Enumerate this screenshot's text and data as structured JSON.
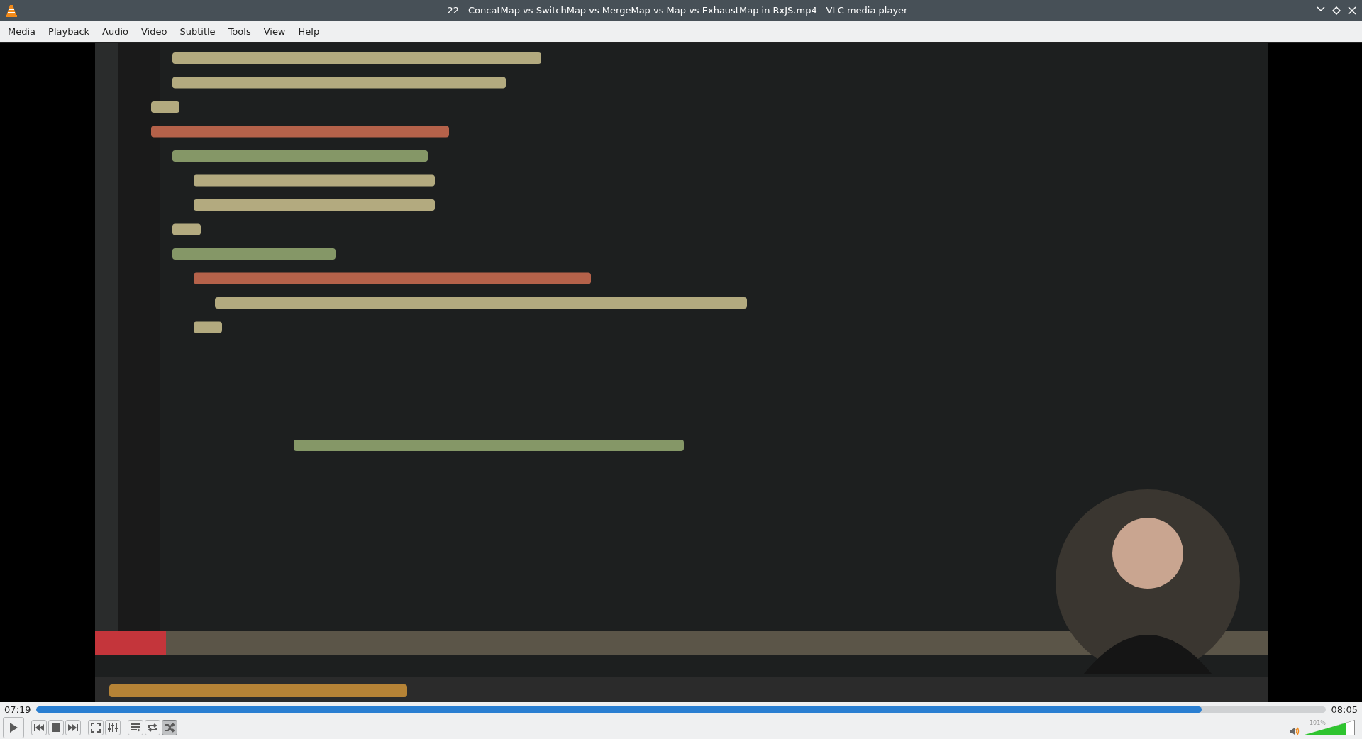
{
  "window": {
    "title": "22 - ConcatMap vs SwitchMap vs MergeMap vs Map vs ExhaustMap in RxJS.mp4 - VLC media player"
  },
  "menu": [
    "Media",
    "Playback",
    "Audio",
    "Video",
    "Subtitle",
    "Tools",
    "View",
    "Help"
  ],
  "video": {
    "kind": "picture"
  },
  "seek": {
    "elapsed": "07:19",
    "total": "08:05",
    "level": 0.904
  },
  "control_groups": [
    [
      {
        "kind": "play",
        "selected": false
      }
    ],
    [
      {
        "kind": "previous",
        "selected": false
      },
      {
        "kind": "stop",
        "selected": false
      },
      {
        "kind": "next",
        "selected": false
      }
    ],
    [
      {
        "kind": "fullscreen",
        "selected": false
      },
      {
        "kind": "effects",
        "selected": false
      }
    ],
    [
      {
        "kind": "playlist",
        "selected": false
      },
      {
        "kind": "loop",
        "selected": false
      },
      {
        "kind": "shuffle",
        "selected": true
      }
    ]
  ],
  "volume": {
    "reading": "101%",
    "level": 0.84
  }
}
